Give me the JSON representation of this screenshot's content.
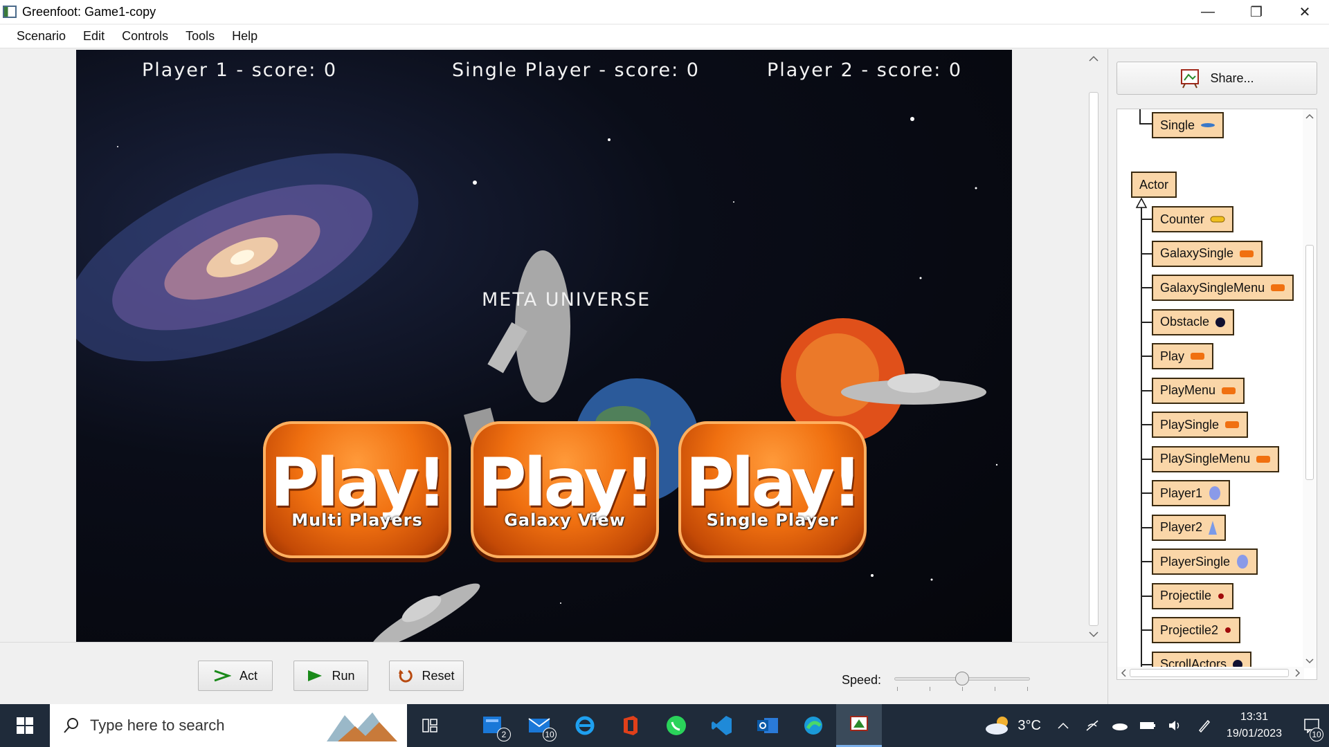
{
  "window": {
    "title": "Greenfoot: Game1-copy",
    "minimize": "—",
    "restore": "❐",
    "close": "✕"
  },
  "menu": [
    "Scenario",
    "Edit",
    "Controls",
    "Tools",
    "Help"
  ],
  "game": {
    "score_p1": "Player 1  - score: 0",
    "score_single": "Single Player - score: 0",
    "score_p2": "Player 2 - score: 0",
    "title": "META UNIVERSE",
    "buttons": [
      {
        "word": "Play!",
        "sub": "Multi Players"
      },
      {
        "word": "Play!",
        "sub": "Galaxy View"
      },
      {
        "word": "Play!",
        "sub": "Single Player"
      }
    ]
  },
  "controls": {
    "act": "Act",
    "run": "Run",
    "reset": "Reset",
    "speed_label": "Speed:",
    "speed_value": 0.5
  },
  "share": {
    "label": "Share..."
  },
  "classes": {
    "world_subclass": "Single",
    "root": "Actor",
    "items": [
      "Counter",
      "GalaxySingle",
      "GalaxySingleMenu",
      "Obstacle",
      "Play",
      "PlayMenu",
      "PlaySingle",
      "PlaySingleMenu",
      "Player1",
      "Player2",
      "PlayerSingle",
      "Projectile",
      "Projectile2",
      "ScrollActors"
    ]
  },
  "taskbar": {
    "search_placeholder": "Type here to search",
    "badge_files": "2",
    "badge_mail": "10",
    "weather": "3°C",
    "time": "13:31",
    "date": "19/01/2023",
    "notifications": "10"
  },
  "colors": {
    "class_fill": "#fad6a8",
    "button_orange": "#f07010",
    "taskbar": "#1f2b3a"
  }
}
